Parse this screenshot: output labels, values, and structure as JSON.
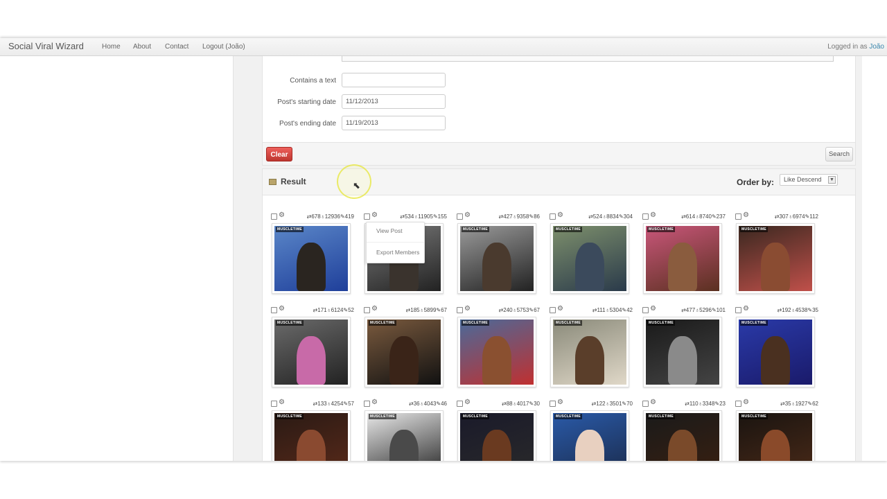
{
  "app": {
    "brand": "Social Viral Wizard"
  },
  "nav": {
    "items": [
      "Home",
      "About",
      "Contact",
      "Logout (João)"
    ]
  },
  "session": {
    "logged_prefix": "Logged in as",
    "user": "João"
  },
  "filters": {
    "contains_label": "Contains a text",
    "contains_value": "",
    "start_label": "Post's starting date",
    "start_value": "11/12/2013",
    "end_label": "Post's ending date",
    "end_value": "11/19/2013"
  },
  "actions": {
    "clear": "Clear",
    "search": "Search"
  },
  "result": {
    "title": "Result",
    "order_label": "Order by:",
    "order_value": "Like Descend"
  },
  "menu": {
    "view_post": "View Post",
    "export_members": "Export Members"
  },
  "posts": [
    {
      "stats": "⇄678♁12936✎419",
      "palette": [
        "#5a86c8",
        "#2a2520",
        "#1f3f9a"
      ]
    },
    {
      "stats": "⇄534♁11905✎155",
      "palette": [
        "#7a7a7a",
        "#3a332d",
        "#222"
      ]
    },
    {
      "stats": "⇄427♁9358✎86",
      "palette": [
        "#9a9a9a",
        "#4a3a2e",
        "#222"
      ]
    },
    {
      "stats": "⇄524♁8834✎304",
      "palette": [
        "#7d8f6c",
        "#3b4a5c",
        "#2a3a4a"
      ]
    },
    {
      "stats": "⇄614♁8740✎237",
      "palette": [
        "#c9567a",
        "#8a5c3e",
        "#5a3020"
      ]
    },
    {
      "stats": "⇄307♁6974✎112",
      "palette": [
        "#3a2820",
        "#8a4c32",
        "#c0504a"
      ]
    },
    {
      "stats": "⇄171♁6124✎52",
      "palette": [
        "#6a6a6a",
        "#c86aa8",
        "#222"
      ]
    },
    {
      "stats": "⇄185♁5899✎67",
      "palette": [
        "#7a5a3e",
        "#3a2418",
        "#111"
      ]
    },
    {
      "stats": "⇄240♁5753✎67",
      "palette": [
        "#4a6a9a",
        "#8a5030",
        "#c03030"
      ]
    },
    {
      "stats": "⇄111♁5304✎42",
      "palette": [
        "#8a8a7a",
        "#5a3e2a",
        "#e0d8c8"
      ]
    },
    {
      "stats": "⇄477♁5296✎101",
      "palette": [
        "#1a1a1a",
        "#8a8a8a",
        "#444"
      ]
    },
    {
      "stats": "⇄192♁4538✎35",
      "palette": [
        "#2a3aa8",
        "#4a3020",
        "#1a1a6a"
      ]
    },
    {
      "stats": "⇄133♁4254✎57",
      "palette": [
        "#2a1a14",
        "#8a4a30",
        "#5a2a1a"
      ]
    },
    {
      "stats": "⇄36♁4043✎46",
      "palette": [
        "#e8e8e8",
        "#4a4a4a",
        "#222"
      ]
    },
    {
      "stats": "⇄88♁4017✎30",
      "palette": [
        "#1a1a2a",
        "#6a3a20",
        "#2a2a2a"
      ]
    },
    {
      "stats": "⇄122♁3501✎70",
      "palette": [
        "#2a5aa8",
        "#e8d0c0",
        "#1a2a4a"
      ]
    },
    {
      "stats": "⇄110♁3348✎23",
      "palette": [
        "#1a1a1a",
        "#7a4a2a",
        "#3a2010"
      ]
    },
    {
      "stats": "⇄35♁1927✎62",
      "palette": [
        "#1a1410",
        "#8a4a2a",
        "#4a2a18"
      ]
    }
  ]
}
